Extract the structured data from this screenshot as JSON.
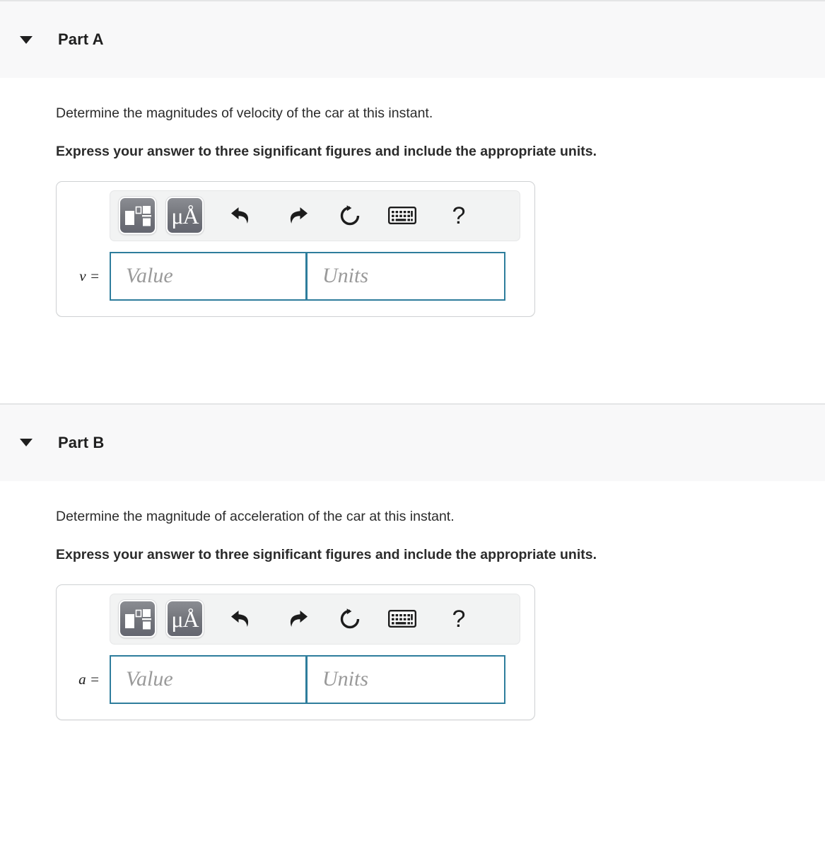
{
  "parts": [
    {
      "id": "part-a",
      "title": "Part A",
      "prompt": "Determine the magnitudes of velocity of the car at this instant.",
      "instruction": "Express your answer to three significant figures and include the appropriate units.",
      "variable_label": "v =",
      "value_placeholder": "Value",
      "units_placeholder": "Units",
      "value_text": "",
      "units_text": ""
    },
    {
      "id": "part-b",
      "title": "Part B",
      "prompt": "Determine the magnitude of acceleration of the car at this instant.",
      "instruction": "Express your answer to three significant figures and include the appropriate units.",
      "variable_label": "a =",
      "value_placeholder": "Value",
      "units_placeholder": "Units",
      "value_text": "",
      "units_text": ""
    }
  ],
  "toolbar": {
    "buttons": [
      {
        "name": "math-templates-icon",
        "label": ""
      },
      {
        "name": "units-micro-angstrom-icon",
        "label": ""
      },
      {
        "name": "undo-icon",
        "label": ""
      },
      {
        "name": "redo-icon",
        "label": ""
      },
      {
        "name": "reset-icon",
        "label": ""
      },
      {
        "name": "keyboard-shortcuts-icon",
        "label": ""
      },
      {
        "name": "help-icon",
        "label": "?"
      }
    ],
    "help_glyph": "?"
  },
  "colors": {
    "header_band": "#f8f8f9",
    "header_border": "#e4e5e6",
    "input_border": "#2e7d9c",
    "answer_box_border": "#cfd1d3",
    "toolbar_bg": "#f2f3f3",
    "placeholder_text": "#9a9a9a",
    "text": "#2b2b2b"
  }
}
